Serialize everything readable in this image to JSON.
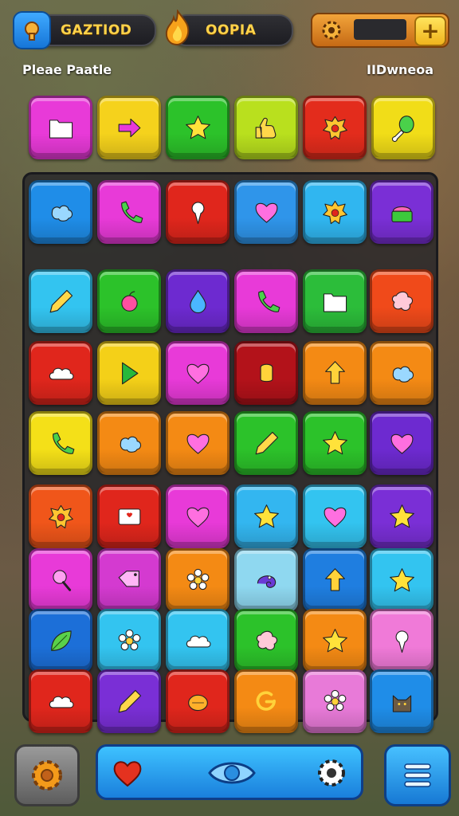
{
  "hud": {
    "player_name": "GAZTIOD",
    "streak_label": "OOPIA",
    "add_button": "+"
  },
  "labels": {
    "left": "Pleae Paatle",
    "right": "IIDwneoa"
  },
  "goal_row": [
    {
      "color": "#e83ad8",
      "icon": "folder-icon"
    },
    {
      "color": "#f5d21c",
      "icon": "arrow-right-icon"
    },
    {
      "color": "#2cc22a",
      "icon": "star-icon"
    },
    {
      "color": "#b9e01e",
      "icon": "thumbs-up-icon"
    },
    {
      "color": "#e32c1c",
      "icon": "crest-icon"
    },
    {
      "color": "#f1dd18",
      "icon": "drumstick-icon"
    }
  ],
  "grid": [
    [
      {
        "color": "#1f8de8",
        "icon": "blob-icon"
      },
      {
        "color": "#e83ad8",
        "icon": "phone-icon"
      },
      {
        "color": "#e0261c",
        "icon": "pin-icon"
      },
      {
        "color": "#2f95ea",
        "icon": "heart-icon"
      },
      {
        "color": "#30b6f0",
        "icon": "crest-icon"
      },
      {
        "color": "#7a2fd6",
        "icon": "cake-icon"
      }
    ],
    [
      {
        "color": "#33c4f0",
        "icon": "pencil-icon"
      },
      {
        "color": "#2cc22a",
        "icon": "apple-icon"
      },
      {
        "color": "#6d2ad0",
        "icon": "drop-icon"
      },
      {
        "color": "#e83ad8",
        "icon": "phone-icon"
      },
      {
        "color": "#2cbd3a",
        "icon": "folder-icon"
      },
      {
        "color": "#f04a1a",
        "icon": "splat-icon"
      }
    ],
    [
      {
        "color": "#e0261c",
        "icon": "cloud-icon"
      },
      {
        "color": "#f4d018",
        "icon": "play-icon"
      },
      {
        "color": "#e83ad8",
        "icon": "heart-icon"
      },
      {
        "color": "#b3121a",
        "icon": "bread-icon"
      },
      {
        "color": "#f48a14",
        "icon": "arrow-up-icon"
      },
      {
        "color": "#f48a14",
        "icon": "blob-icon"
      }
    ],
    [
      {
        "color": "#f4e018",
        "icon": "phone-icon"
      },
      {
        "color": "#f48a14",
        "icon": "blob-icon"
      },
      {
        "color": "#f48a14",
        "icon": "heart-icon"
      },
      {
        "color": "#2cc22a",
        "icon": "pencil-icon"
      },
      {
        "color": "#2cc22a",
        "icon": "star-icon"
      },
      {
        "color": "#6d2ad0",
        "icon": "heart-icon"
      }
    ],
    [
      {
        "color": "#f0561a",
        "icon": "crest-icon"
      },
      {
        "color": "#e0261c",
        "icon": "card-icon"
      },
      {
        "color": "#e83ad8",
        "icon": "heart-icon"
      },
      {
        "color": "#33b6f0",
        "icon": "star-icon"
      },
      {
        "color": "#33c4f0",
        "icon": "heart-icon"
      },
      {
        "color": "#7a2fd6",
        "icon": "star-icon"
      }
    ],
    [
      {
        "color": "#e83ad8",
        "icon": "lollipop-icon"
      },
      {
        "color": "#d43ad0",
        "icon": "tag-icon"
      },
      {
        "color": "#f48a14",
        "icon": "flower-icon"
      },
      {
        "color": "#8fd8f0",
        "icon": "chameleon-icon"
      },
      {
        "color": "#1f7ee0",
        "icon": "arrow-up-icon"
      },
      {
        "color": "#33c4f0",
        "icon": "star-icon"
      }
    ],
    [
      {
        "color": "#1c6fd8",
        "icon": "leaf-icon"
      },
      {
        "color": "#33c4f0",
        "icon": "flower-icon"
      },
      {
        "color": "#33c4f0",
        "icon": "cloud-icon"
      },
      {
        "color": "#2cc22a",
        "icon": "splat-icon"
      },
      {
        "color": "#f48a14",
        "icon": "star-icon"
      },
      {
        "color": "#f07ad8",
        "icon": "pin-icon"
      }
    ],
    [
      {
        "color": "#e0261c",
        "icon": "cloud-icon"
      },
      {
        "color": "#7a2fd6",
        "icon": "pencil-icon"
      },
      {
        "color": "#e0261c",
        "icon": "fruit-icon"
      },
      {
        "color": "#f48a14",
        "icon": "swirl-icon"
      },
      {
        "color": "#e87ad8",
        "icon": "flower-icon"
      },
      {
        "color": "#1f8de8",
        "icon": "cat-icon"
      }
    ]
  ],
  "bottom_bar": {
    "items": [
      "heart-icon",
      "eye-icon",
      "gear-icon"
    ]
  }
}
